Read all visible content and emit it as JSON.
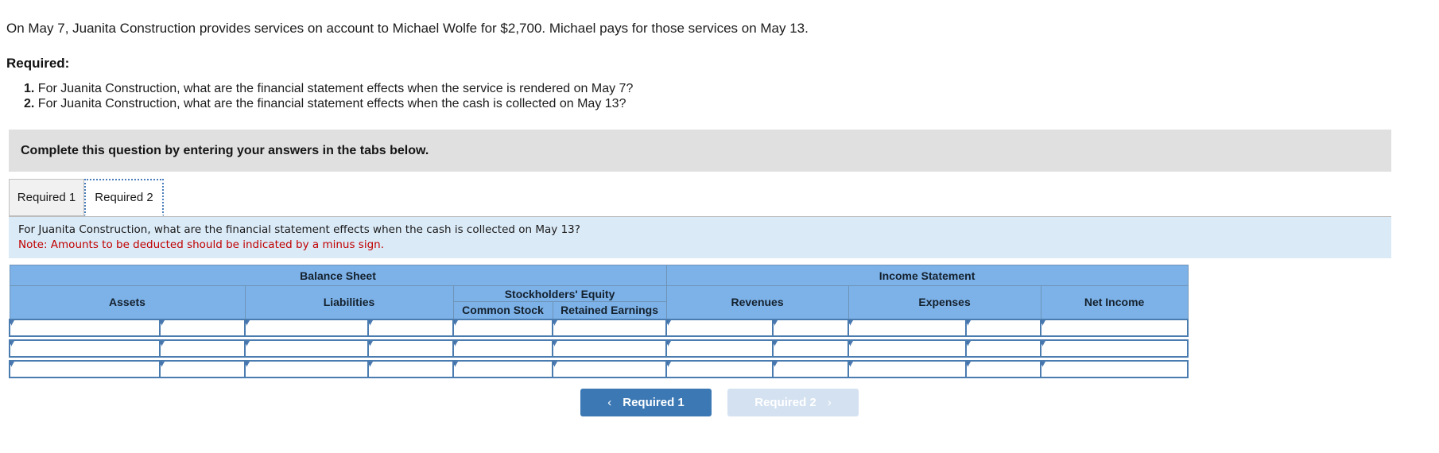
{
  "problem": {
    "statement": "On May 7, Juanita Construction provides services on account to Michael Wolfe for $2,700. Michael pays for those services on May 13.",
    "required_label": "Required:",
    "requirements": [
      {
        "num": "1.",
        "text": "For Juanita Construction, what are the financial statement effects when the service is rendered on May 7?"
      },
      {
        "num": "2.",
        "text": "For Juanita Construction, what are the financial statement effects when the cash is collected on May 13?"
      }
    ]
  },
  "gray_banner": {
    "text": "Complete this question by entering your answers in the tabs below."
  },
  "tabs": [
    {
      "label": "Required 1",
      "active": false
    },
    {
      "label": "Required 2",
      "active": true
    }
  ],
  "info_banner": {
    "question": "For Juanita Construction, what are the financial statement effects when the cash is collected on May 13?",
    "note": "Note: Amounts to be deducted should be indicated by a minus sign.",
    "background": "#dbeaf7",
    "note_color": "#c00000"
  },
  "table": {
    "group_headers": [
      {
        "label": "Balance Sheet"
      },
      {
        "label": "Income Statement"
      }
    ],
    "stockholders_equity_label": "Stockholders' Equity",
    "columns": [
      {
        "label": "Assets"
      },
      {
        "label": "Liabilities"
      },
      {
        "label": "Common Stock"
      },
      {
        "label": "Retained Earnings"
      },
      {
        "label": "Revenues"
      },
      {
        "label": "Expenses"
      },
      {
        "label": "Net Income"
      }
    ],
    "row_count": 3,
    "cell_values": [
      [
        "",
        "",
        "",
        "",
        "",
        "",
        "",
        "",
        "",
        "",
        ""
      ],
      [
        "",
        "",
        "",
        "",
        "",
        "",
        "",
        "",
        "",
        "",
        ""
      ],
      [
        "",
        "",
        "",
        "",
        "",
        "",
        "",
        "",
        "",
        "",
        ""
      ]
    ],
    "header_color": "#7db2e8",
    "cell_border_color": "#4b7cb0"
  },
  "nav": {
    "prev": {
      "label": "Required 1",
      "icon": "chevron-left",
      "glyph": "‹",
      "enabled": true,
      "color": "#3b78b4"
    },
    "next": {
      "label": "Required 2",
      "icon": "chevron-right",
      "glyph": "›",
      "enabled": false,
      "color": "#d4e1f0"
    }
  }
}
